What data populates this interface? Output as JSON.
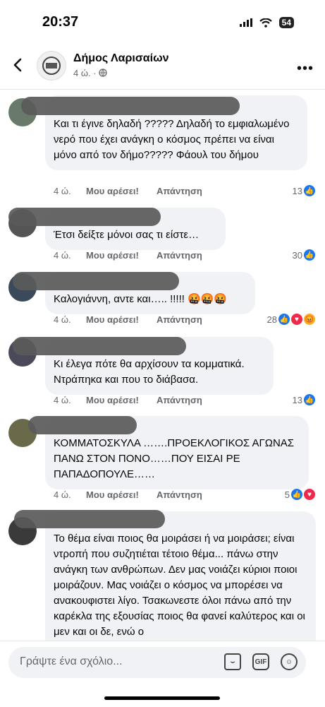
{
  "status": {
    "time": "20:37",
    "battery": "54"
  },
  "header": {
    "title": "Δήμος Λαρισαίων",
    "meta": "4 ώ. ·"
  },
  "comments": [
    {
      "text": "Και τι έγινε δηλαδή ????? Δηλαδή το εμφιαλωμένο νερό που έχει ανάγκη ο κόσμος πρέπει να είναι μόνο από τον δήμο????? Φάουλ του δήμου",
      "time": "4 ώ.",
      "like": "Μου αρέσει!",
      "reply": "Απάντηση",
      "count": "13"
    },
    {
      "text": "Έτσι δείξτε μόνοι σας τι είστε…",
      "time": "4 ώ.",
      "like": "Μου αρέσει!",
      "reply": "Απάντηση",
      "count": "30"
    },
    {
      "text": "Καλογιάννη, αντε και….. !!!!! 🤬🤬🤬",
      "time": "4 ώ.",
      "like": "Μου αρέσει!",
      "reply": "Απάντηση",
      "count": "28"
    },
    {
      "text": "Κι έλεγα πότε θα αρχίσουν τα κομματικά. Ντράπηκα και που το διάβασα.",
      "time": "4 ώ.",
      "like": "Μου αρέσει!",
      "reply": "Απάντηση",
      "count": "13"
    },
    {
      "text": "ΚΟΜΜΑΤΟΣΚΥΛΑ …….ΠΡΟΕΚΛΟΓΙΚΟΣ ΑΓΩΝΑΣ ΠΑΝΩ ΣΤΟΝ ΠΟΝΟ……ΠΟΥ ΕΙΣΑΙ ΡΕ ΠΑΠΑΔΟΠΟΥΛΕ……",
      "time": "4 ώ.",
      "like": "Μου αρέσει!",
      "reply": "Απάντηση",
      "count": "5"
    },
    {
      "text": "Το θέμα είναι ποιος θα μοιράσει ή να μοιράσει; είναι ντροπή που συζητιέται τέτοιο θέμα... πάνω στην ανάγκη των ανθρώπων. Δεν μας νοιάζει κύριοι ποιοι μοιράζουν. Μας νοιάζει ο κόσμος να μπορέσει να ανακουφιστει λίγο. Τσακωνεστε όλοι πάνω από την καρέκλα της εξουσίας ποιος θα φανεί καλύτερος και οι μεν και οι δε, ενώ ο"
    }
  ],
  "composer": {
    "placeholder": "Γράψτε ένα σχόλιο...",
    "gif": "GIF"
  },
  "colors": {
    "like": "#1877f2",
    "bubble": "#f0f2f5",
    "meta": "#65676b"
  }
}
